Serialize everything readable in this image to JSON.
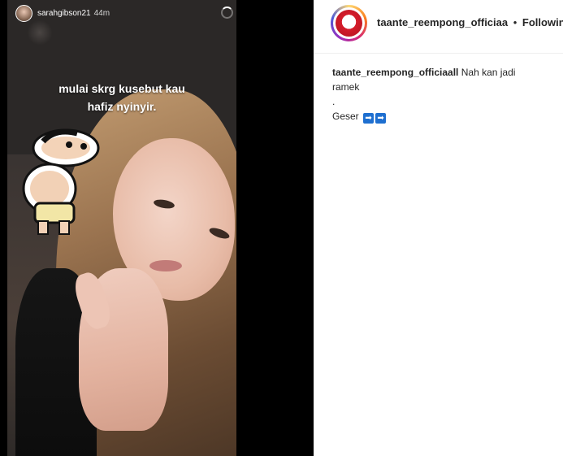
{
  "story": {
    "username": "sarahgibson21",
    "time": "44m",
    "caption_line1": "mulai skrg kusebut kau",
    "caption_line2": "hafiz nyinyir.",
    "sticker_icon": "shinchan-sticker-icon"
  },
  "post": {
    "header": {
      "username": "taante_reempong_officiaa",
      "separator": "•",
      "follow_label": "Followin"
    },
    "caption": {
      "username": "taante_reempong_officiaall",
      "text_line1": "Nah kan jadi",
      "text_line2": "ramek",
      "text_line3": ".",
      "text_line4": "Geser",
      "arrow_icon": "right-arrow-emoji",
      "arrow_glyph": "➡"
    }
  },
  "colors": {
    "accent_blue": "#1e6fd0",
    "text": "#262626",
    "media_bg": "#000000"
  }
}
